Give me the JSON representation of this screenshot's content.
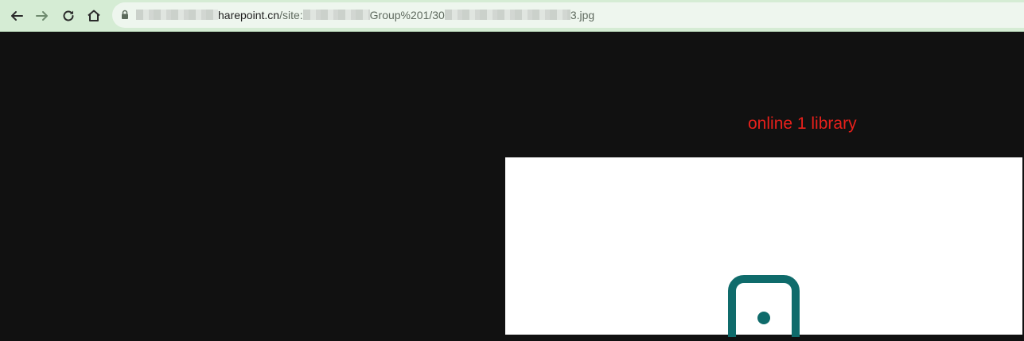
{
  "browser": {
    "address": {
      "url_part_1": "",
      "url_part_2": "harepoint.cn",
      "url_part_3": "/site:",
      "url_part_4": "",
      "url_part_5": "Group%201/30",
      "url_part_6": "",
      "url_part_7": "3.jpg"
    },
    "icons": {
      "back": "back-arrow-icon",
      "forward": "forward-arrow-icon",
      "reload": "reload-icon",
      "home": "home-icon",
      "lock": "lock-icon"
    }
  },
  "viewer": {
    "caption": "online 1 library",
    "caption_color": "#e8201b",
    "background_color": "#111111",
    "icon": "phone-device-icon",
    "icon_color": "#0f6b6b"
  }
}
